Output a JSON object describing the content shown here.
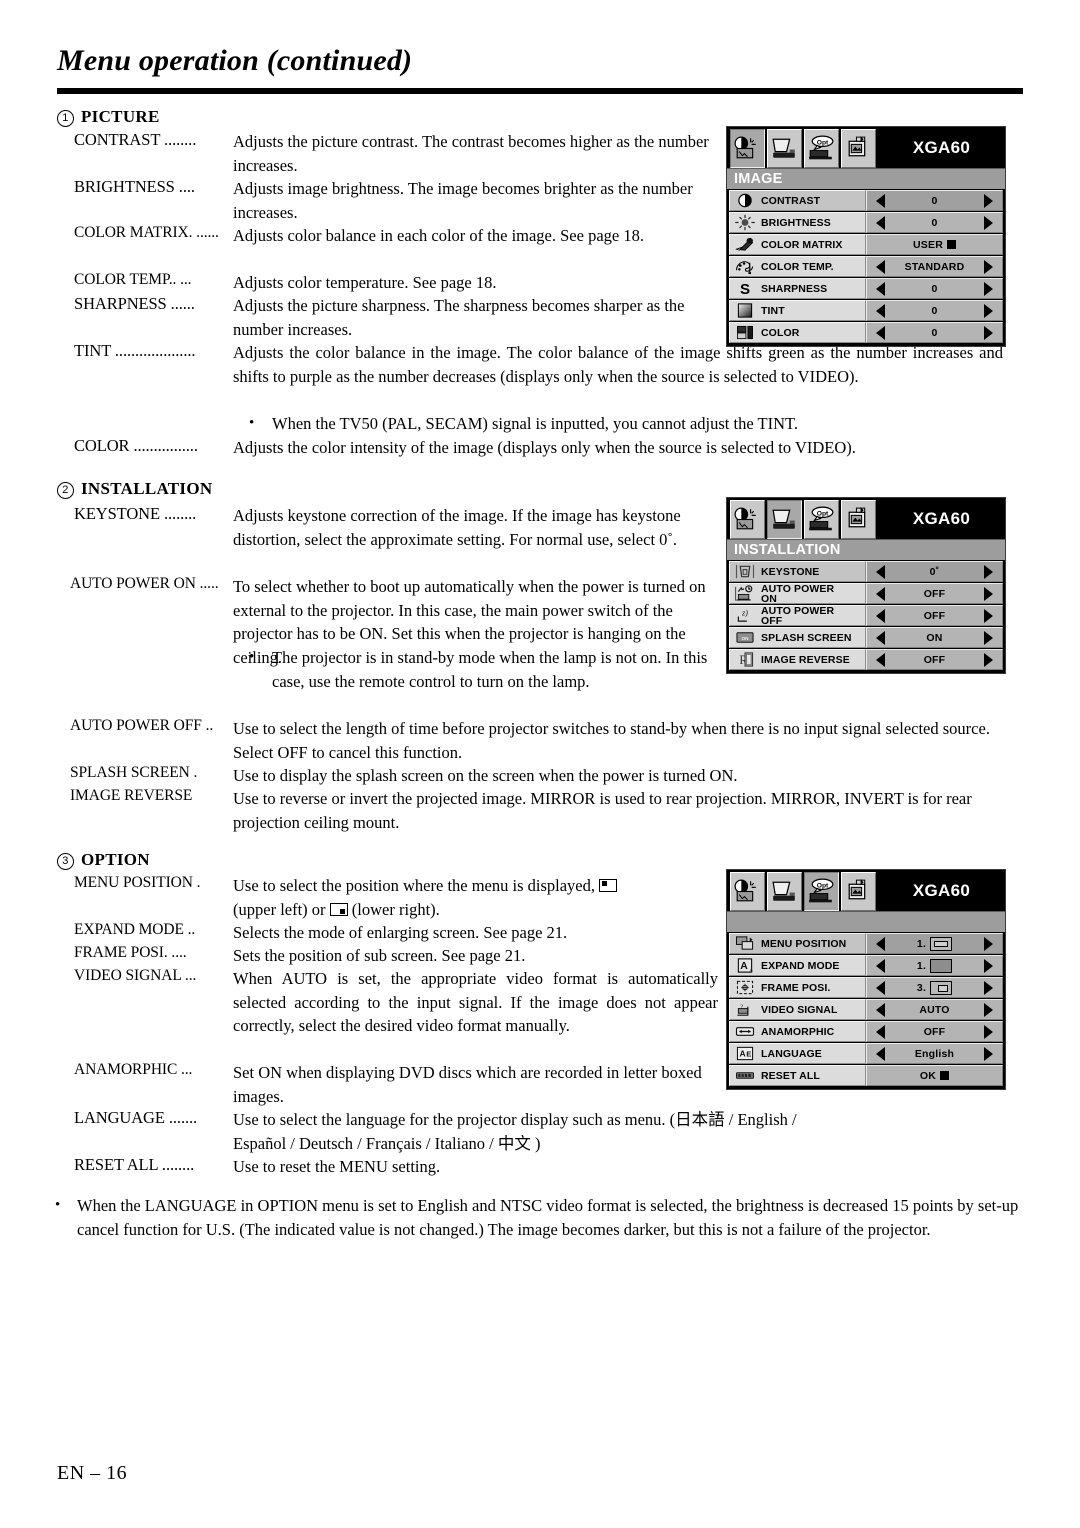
{
  "header": {
    "title": "Menu operation (continued)"
  },
  "footer": {
    "page_label": "EN – 16"
  },
  "sections": {
    "picture": {
      "number": "1",
      "heading": "PICTURE",
      "items": {
        "contrast": {
          "term": "CONTRAST ........",
          "desc": "Adjusts the picture contrast. The contrast becomes higher as the number increases."
        },
        "brightness": {
          "term": "BRIGHTNESS ....",
          "desc": "Adjusts image brightness. The image becomes brighter as the number increases."
        },
        "color_matrix": {
          "term": "COLOR MATRIX. ......",
          "desc": "Adjusts color balance in each color of the image. See page 18."
        },
        "color_temp": {
          "term": "COLOR TEMP.. ...",
          "desc": "Adjusts color temperature. See page 18."
        },
        "sharpness": {
          "term": "SHARPNESS ......",
          "desc": "Adjusts the picture sharpness. The sharpness becomes sharper as the number increases."
        },
        "tint": {
          "term": "TINT ....................",
          "desc": "Adjusts the color balance in the image.  The color balance of the image shifts green as the number increases and shifts to purple as the number decreases (displays only when the source is selected to VIDEO).",
          "note": "When the TV50 (PAL, SECAM) signal is inputted, you cannot adjust the TINT."
        },
        "color": {
          "term": "COLOR ................",
          "desc": "Adjusts the color intensity of the image (displays only when the source is selected to VIDEO)."
        }
      }
    },
    "installation": {
      "number": "2",
      "heading": "INSTALLATION",
      "items": {
        "keystone": {
          "term": "KEYSTONE ........",
          "desc": "Adjusts keystone correction of the image. If the image has keystone distortion, select the approximate setting. For normal use, select 0˚."
        },
        "auto_power_on": {
          "term": "AUTO POWER ON .....",
          "desc": "To select whether to boot up automatically when the power is turned on external to the projector. In this case, the main power switch of the projector has to be ON.  Set this when the projector is hanging on the ceiling.",
          "note": "The projector is in stand-by mode when the lamp is not on. In this case, use the remote control to turn on the lamp."
        },
        "auto_power_off": {
          "term": "AUTO POWER OFF ..",
          "desc": "Use to select the length of time before projector switches to stand-by when there is no input signal selected source. Select OFF to cancel this function."
        },
        "splash_screen": {
          "term": "SPLASH SCREEN .",
          "desc": "Use to display the splash screen on the screen when the power is turned ON."
        },
        "image_reverse": {
          "term": "IMAGE REVERSE",
          "desc": "Use to reverse or invert the projected image.  MIRROR is used to rear projection. MIRROR, INVERT is for rear projection ceiling mount."
        }
      }
    },
    "option": {
      "number": "3",
      "heading": "OPTION",
      "items": {
        "menu_position": {
          "term": "MENU POSITION .",
          "desc_a": "Use to select the position where the menu is displayed,",
          "desc_b": "(upper left) or",
          "desc_c": "(lower right)."
        },
        "expand_mode": {
          "term": "EXPAND MODE ..",
          "desc": "Selects the mode of enlarging screen. See page 21."
        },
        "frame_posi": {
          "term": "FRAME POSI. ....",
          "desc": "Sets the position of sub screen. See page 21."
        },
        "video_signal": {
          "term": "VIDEO SIGNAL ...",
          "desc": "When AUTO is set, the appropriate video format is automatically selected according to the input signal. If the image does not appear correctly, select the desired video format manually."
        },
        "anamorphic": {
          "term": "ANAMORPHIC ...",
          "desc": "Set ON when displaying DVD discs which are recorded in letter boxed images."
        },
        "language": {
          "term": "LANGUAGE .......",
          "desc": "Use to select the language for the projector display such as menu. (日本語 / English / Español / Deutsch / Français / Italiano / 中文 )"
        },
        "reset_all": {
          "term": "RESET ALL ........",
          "desc": "Use to reset the MENU setting."
        }
      }
    }
  },
  "final_note": "When the LANGUAGE in OPTION menu is set to English and NTSC video format is selected, the brightness is decreased 15 points by set-up cancel function for U.S. (The indicated value is not changed.) The image becomes darker, but this is not a failure of the projector.",
  "osd": {
    "signal_label": "XGA60",
    "tabs": [
      "image-tab-icon",
      "installation-tab-icon",
      "option-tab-icon",
      "feature-tab-icon"
    ],
    "image_menu": {
      "title": "IMAGE",
      "active_tab": 0,
      "rows": [
        {
          "icon": "contrast-icon",
          "label": "CONTRAST",
          "value": "0",
          "arrows": true,
          "selected": true
        },
        {
          "icon": "brightness-icon",
          "label": "BRIGHTNESS",
          "value": "0",
          "arrows": true,
          "selected": false
        },
        {
          "icon": "color-matrix-icon",
          "label": "COLOR MATRIX",
          "value": "USER",
          "arrows": false,
          "square": true,
          "selected": false
        },
        {
          "icon": "color-temp-icon",
          "label": "COLOR TEMP.",
          "value": "STANDARD",
          "arrows": true,
          "selected": false
        },
        {
          "icon": "sharpness-icon",
          "label": "SHARPNESS",
          "value": "0",
          "arrows": true,
          "selected": false
        },
        {
          "icon": "tint-icon",
          "label": "TINT",
          "value": "0",
          "arrows": true,
          "selected": false
        },
        {
          "icon": "color-icon",
          "label": "COLOR",
          "value": "0",
          "arrows": true,
          "selected": false
        }
      ]
    },
    "installation_menu": {
      "title": "INSTALLATION",
      "active_tab": 1,
      "rows": [
        {
          "icon": "keystone-icon",
          "label": "KEYSTONE",
          "value": "0˚",
          "arrows": true,
          "selected": true
        },
        {
          "icon": "auto-power-on-icon",
          "label": "AUTO POWER\nON",
          "value": "OFF",
          "arrows": true,
          "selected": false
        },
        {
          "icon": "auto-power-off-icon",
          "label": "AUTO POWER\nOFF",
          "value": "OFF",
          "arrows": true,
          "selected": false
        },
        {
          "icon": "splash-screen-icon",
          "label": "SPLASH SCREEN",
          "value": "ON",
          "arrows": true,
          "selected": false
        },
        {
          "icon": "image-reverse-icon",
          "label": "IMAGE REVERSE",
          "value": "OFF",
          "arrows": true,
          "selected": false
        }
      ]
    },
    "option_menu": {
      "title": "",
      "active_tab": 2,
      "rows": [
        {
          "icon": "menu-position-icon",
          "label": "MENU POSITION",
          "value": "1.",
          "arrows": true,
          "box": "wide",
          "selected": true
        },
        {
          "icon": "expand-mode-icon",
          "label": "EXPAND MODE",
          "value": "1.",
          "arrows": true,
          "box": "expd",
          "selected": false
        },
        {
          "icon": "frame-posi-icon",
          "label": "FRAME POSI.",
          "value": "3.",
          "arrows": true,
          "box": "small",
          "selected": false
        },
        {
          "icon": "video-signal-icon",
          "label": "VIDEO SIGNAL",
          "value": "AUTO",
          "arrows": true,
          "selected": false
        },
        {
          "icon": "anamorphic-icon",
          "label": "ANAMORPHIC",
          "value": "OFF",
          "arrows": true,
          "selected": false
        },
        {
          "icon": "language-icon",
          "label": "LANGUAGE",
          "value": "English",
          "arrows": true,
          "selected": false
        },
        {
          "icon": "reset-all-icon",
          "label": "RESET ALL",
          "value": "OK",
          "arrows": false,
          "square": true,
          "selected": false
        }
      ]
    }
  }
}
